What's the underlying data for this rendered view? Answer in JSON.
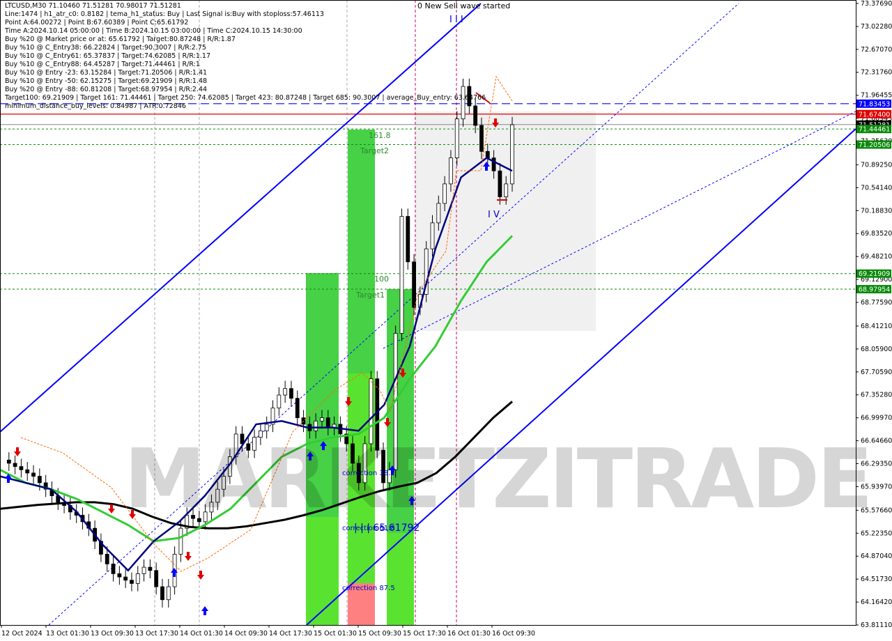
{
  "symbol_line": "LTCUSD,M30  71.10460 71.51281 70.98017 71.51281",
  "info_lines": [
    "Line:1474  |  h1_atr_c0: 0.8182  |  tema_h1_status: Buy  |  Last Signal is:Buy with stoploss:57.46113",
    "Point A:64.00272  |  Point B:67.60389  |  Point C:65.61792",
    "Time A:2024.10.14 05:00:00  |  Time B:2024.10.15 03:00:00  |  Time C:2024.10.15 14:30:00",
    "Buy %20 @ Market price or at: 65.61792  |  Target:80.87248  |  R/R:1.87",
    "Buy %10 @ C_Entry38: 66.22824  |  Target:90.3007  |  R/R:2.75",
    "Buy %10 @ C_Entry61: 65.37837  |  Target:74.62085  |  R/R:1.17",
    "Buy %10 @ C_Entry88: 64.45287  |  Target:71.44461  |  R/R:1",
    "Buy %10 @ Entry -23: 63.15284  |  Target:71.20506  |  R/R:1.41",
    "Buy %10 @ Entry -50: 62.15275  |  Target:69.21909  |  R/R:1.48",
    "Buy %20 @ Entry -88: 60.81208  |  Target:68.97954  |  R/R:2.44",
    "Target100: 69.21909  |  Target 161: 71.44461  |  Target 250: 74.62085  |  Target 423: 80.87248  |  Target 685: 90.3007  |  average_Buy_entry: 63.64766",
    "minimum_distance_buy_levels: 0.84987  |  ATR:0.72846"
  ],
  "watermark": "MARKETZITRADE",
  "colors": {
    "bull": "#0a8a0a",
    "bear": "#000000",
    "blue_channel": "#0000ff",
    "red_level": "#e00000",
    "green_zone": "#33cc33",
    "pink_zone": "#ff8080"
  },
  "labels": {
    "new_sell_wave": "0 New Sell wave started",
    "wave_iii": "I I I",
    "wave_iv": "I V",
    "fib_161": "161.8",
    "target2": "Target2",
    "fib_100": "100",
    "target1": "Target1",
    "correction_38": "correction 38.2",
    "correction_61": "correction 61.8",
    "correction_87": "correction 87.5",
    "point_c": "| | | 65.61792"
  },
  "chart_data": {
    "type": "candlestick",
    "symbol": "LTCUSD",
    "timeframe": "M30",
    "ylim": [
      63.8111,
      73.3765
    ],
    "y_ticks": [
      "73.37690",
      "73.02280",
      "72.67070",
      "72.31760",
      "71.96455",
      "71.60945",
      "71.25630",
      "70.89250",
      "70.54140",
      "70.18830",
      "69.83520",
      "69.48210",
      "69.12900",
      "68.77590",
      "68.41210",
      "68.05900",
      "67.70590",
      "67.35280",
      "66.99970",
      "66.64660",
      "66.29350",
      "65.93970",
      "65.57660",
      "65.22350",
      "64.87040",
      "64.51730",
      "64.16420",
      "63.81110"
    ],
    "x_ticks": [
      "12 Oct 2024",
      "13 Oct 01:30",
      "13 Oct 09:30",
      "13 Oct 17:30",
      "14 Oct 01:30",
      "14 Oct 09:30",
      "14 Oct 17:30",
      "15 Oct 01:30",
      "15 Oct 09:30",
      "15 Oct 17:30",
      "16 Oct 01:30",
      "16 Oct 09:30"
    ],
    "price_tags": [
      {
        "value": "71.83453",
        "price": 71.83453,
        "color": "#0000ff"
      },
      {
        "value": "71.67400",
        "price": 71.674,
        "color": "#e00000"
      },
      {
        "value": "71.51281",
        "price": 71.51281,
        "color": "#000000"
      },
      {
        "value": "71.44461",
        "price": 71.44461,
        "color": "#0a8a0a"
      },
      {
        "value": "71.20506",
        "price": 71.20506,
        "color": "#0a8a0a"
      },
      {
        "value": "69.21909",
        "price": 69.21909,
        "color": "#0a8a0a"
      },
      {
        "value": "68.97954",
        "price": 68.97954,
        "color": "#0a8a0a"
      }
    ],
    "close_path": [
      66.35,
      66.3,
      66.25,
      66.2,
      66.15,
      66.1,
      66.0,
      65.9,
      65.8,
      65.7,
      65.65,
      65.55,
      65.5,
      65.4,
      65.3,
      65.1,
      64.9,
      64.75,
      64.6,
      64.55,
      64.5,
      64.45,
      64.6,
      64.7,
      64.65,
      64.4,
      64.2,
      64.4,
      64.9,
      65.3,
      65.5,
      65.45,
      65.4,
      65.55,
      65.7,
      65.9,
      66.1,
      66.4,
      66.75,
      66.6,
      66.5,
      66.7,
      66.8,
      66.9,
      67.15,
      67.35,
      67.45,
      67.3,
      67.0,
      66.9,
      66.8,
      66.95,
      67.0,
      66.85,
      66.9,
      66.75,
      66.6,
      66.3,
      66.0,
      66.6,
      67.6,
      66.5,
      66.0,
      66.2,
      68.3,
      70.1,
      69.4,
      68.7,
      68.9,
      69.6,
      70.0,
      70.3,
      70.6,
      71.0,
      71.6,
      72.1,
      71.8,
      71.5,
      71.1,
      71.0,
      70.8,
      70.4,
      70.6,
      71.51
    ],
    "ma_black": [
      65.6,
      65.63,
      65.66,
      65.68,
      65.7,
      65.7,
      65.67,
      65.6,
      65.48,
      65.38,
      65.32,
      65.3,
      65.3,
      65.33,
      65.38,
      65.43,
      65.5,
      65.58,
      65.68,
      65.78,
      65.87,
      65.94,
      66.0,
      66.15,
      66.4,
      66.7,
      67.0,
      67.25
    ],
    "ma_green": [
      66.2,
      66.0,
      65.9,
      65.75,
      65.55,
      65.35,
      65.1,
      65.15,
      65.35,
      65.6,
      66.0,
      66.4,
      66.6,
      66.7,
      66.75,
      67.0,
      67.6,
      68.1,
      68.8,
      69.4,
      69.8
    ],
    "ma_blue": [
      66.1,
      66.0,
      65.9,
      65.55,
      65.05,
      64.65,
      65.1,
      65.4,
      65.8,
      66.3,
      66.9,
      66.95,
      66.85,
      66.85,
      66.8,
      67.2,
      68.1,
      69.6,
      70.7,
      71.0,
      70.8
    ]
  }
}
